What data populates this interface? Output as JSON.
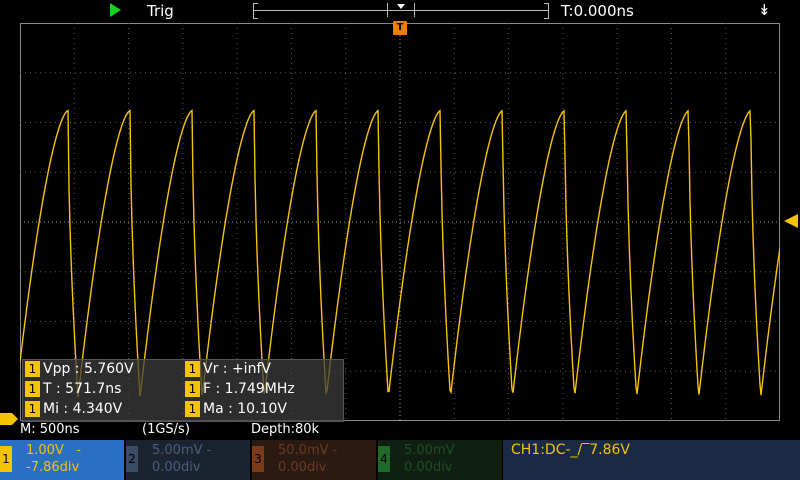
{
  "top": {
    "run_state": "running",
    "trigger_label": "Trig",
    "time_offset": "T:0.000ns"
  },
  "markers": {
    "trigger_position_label": "T",
    "ch1_marker": "1"
  },
  "measurements": [
    {
      "ch": "1",
      "text": "Vpp : 5.760V"
    },
    {
      "ch": "1",
      "text": "Vr : +infV"
    },
    {
      "ch": "1",
      "text": "T : 571.7ns"
    },
    {
      "ch": "1",
      "text": "F : 1.749MHz"
    },
    {
      "ch": "1",
      "text": "Mi : 4.340V"
    },
    {
      "ch": "1",
      "text": "Ma : 10.10V"
    }
  ],
  "status": {
    "timebase": "M: 500ns",
    "sample_rate": "(1GS/s)",
    "depth": "Depth:80k"
  },
  "channels": [
    {
      "num": "1",
      "scale": "1.00V",
      "coupling_mark": "-",
      "offset": "-7.86div",
      "active": true
    },
    {
      "num": "2",
      "scale": "5.00mV",
      "coupling_mark": "-",
      "offset": "0.00div",
      "active": false
    },
    {
      "num": "3",
      "scale": "50.0mV",
      "coupling_mark": "-",
      "offset": "0.00div",
      "active": false
    },
    {
      "num": "4",
      "scale": "5.00mV",
      "coupling_mark": "",
      "offset": "0.00div",
      "active": false
    }
  ],
  "trigger_info": "CH1:DC-_/‾7.86V",
  "colors": {
    "ch1": "#f5c400",
    "trigger_marker": "#f07d00",
    "run_icon": "#19d21f",
    "ch1_box": "#2a6fc2"
  },
  "waveform": {
    "type": "sawtooth-like periodic",
    "period_ns": 571.7,
    "frequency": "1.749MHz",
    "min_v": 4.34,
    "max_v": 10.1,
    "timebase_per_div_ns": 500,
    "volts_per_div": 1.0
  }
}
